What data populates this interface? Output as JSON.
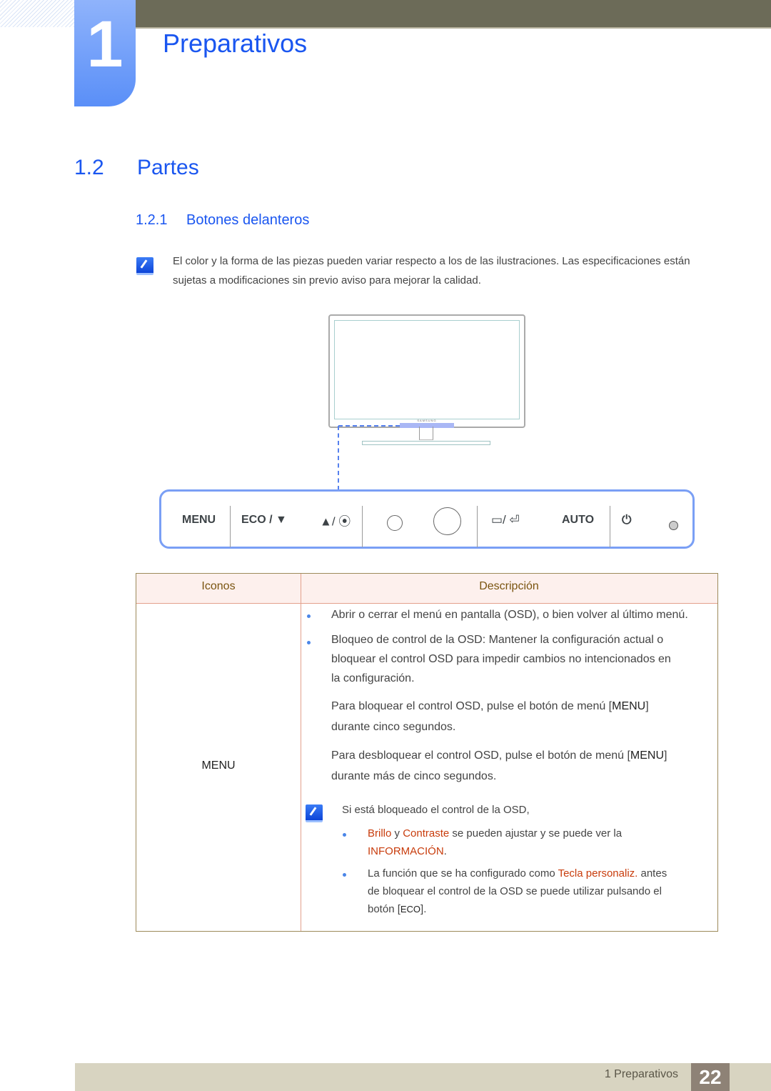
{
  "chapter": {
    "number": "1",
    "title": "Preparativos"
  },
  "section": {
    "number": "1.2",
    "title": "Partes"
  },
  "subsection": {
    "number": "1.2.1",
    "title": "Botones delanteros"
  },
  "note": {
    "icon": "note-pencil-icon",
    "text": "El color y la forma de las piezas pueden variar respecto a los de las ilustraciones. Las especificaciones están sujetas a modificaciones sin previo aviso para mejorar la calidad."
  },
  "monitor": {
    "brand": "SAMSUNG"
  },
  "panel": {
    "buttons": [
      {
        "label": "MENU"
      },
      {
        "label": "ECO / ▼"
      },
      {
        "label": "▲/ ⦿"
      },
      {
        "label": "▭/ ⏎"
      },
      {
        "label": "AUTO"
      },
      {
        "label": "⏻"
      }
    ]
  },
  "table": {
    "headers": [
      "Iconos",
      "Descripción"
    ],
    "row": {
      "icon_label": "MENU",
      "bullet1": "Abrir o cerrar el menú en pantalla (OSD), o bien volver al último menú.",
      "bullet2_l1": "Bloqueo de control de la OSD: Mantener la configuración actual o",
      "bullet2_l2": "bloquear el control OSD para impedir cambios no intencionados en",
      "bullet2_l3": "la configuración.",
      "para1_a": "Para bloquear el control OSD, pulse el botón de menú [",
      "para1_key": "MENU",
      "para1_b": "]",
      "para1_l2": "durante cinco segundos.",
      "para2_a": "Para desbloquear el control OSD, pulse el botón de menú [",
      "para2_key": "MENU",
      "para2_b": "]",
      "para2_l2": "durante más de cinco segundos.",
      "note_intro": "Si está bloqueado el control de la OSD,",
      "sub1_hl1": "Brillo",
      "sub1_y": " y ",
      "sub1_hl2": "Contraste",
      "sub1_rest": " se pueden ajustar y se puede ver la",
      "sub1_hl3": "INFORMACIÓN",
      "sub1_end": ".",
      "sub2_a": "La función que se ha configurado como ",
      "sub2_hl": "Tecla personaliz.",
      "sub2_b": " antes",
      "sub2_l2": "de bloquear el control de la OSD se puede utilizar pulsando el",
      "sub2_l3a": "botón [",
      "sub2_key": "ECO",
      "sub2_l3b": "]."
    }
  },
  "footer": {
    "chapter_label": "1 Preparativos",
    "page": "22"
  },
  "colors": {
    "accent_blue": "#1a56f0",
    "highlight": "#c83c0c",
    "header_bar": "#6c6b58",
    "footer": "#d8d4c1"
  }
}
